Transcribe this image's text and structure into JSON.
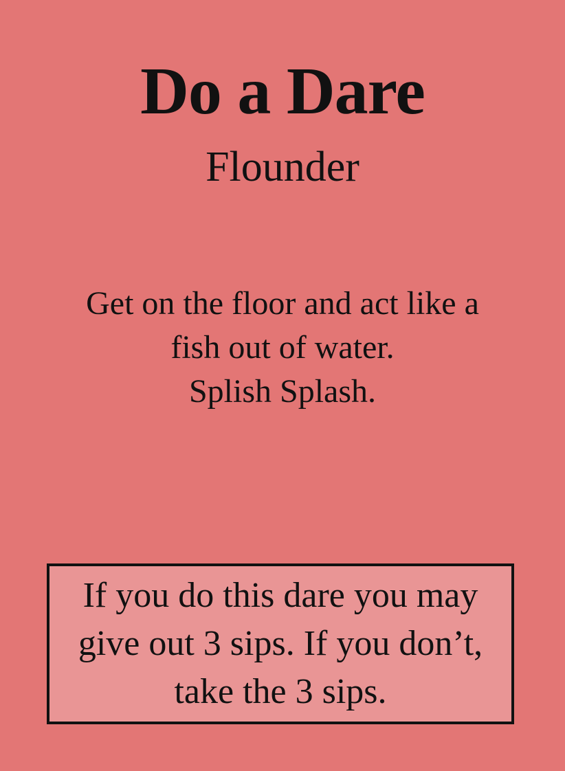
{
  "card": {
    "title": "Do a Dare",
    "subtitle": "Flounder",
    "body_lines": [
      "Get on the floor and act like a",
      "fish out of water.",
      "Splish Splash."
    ],
    "rule_lines": [
      "If you do this dare you may",
      "give out 3 sips. If you don’t,",
      "take the 3 sips."
    ]
  },
  "colors": {
    "background": "#e37675",
    "box_fill": "#e99595",
    "text": "#111111"
  }
}
